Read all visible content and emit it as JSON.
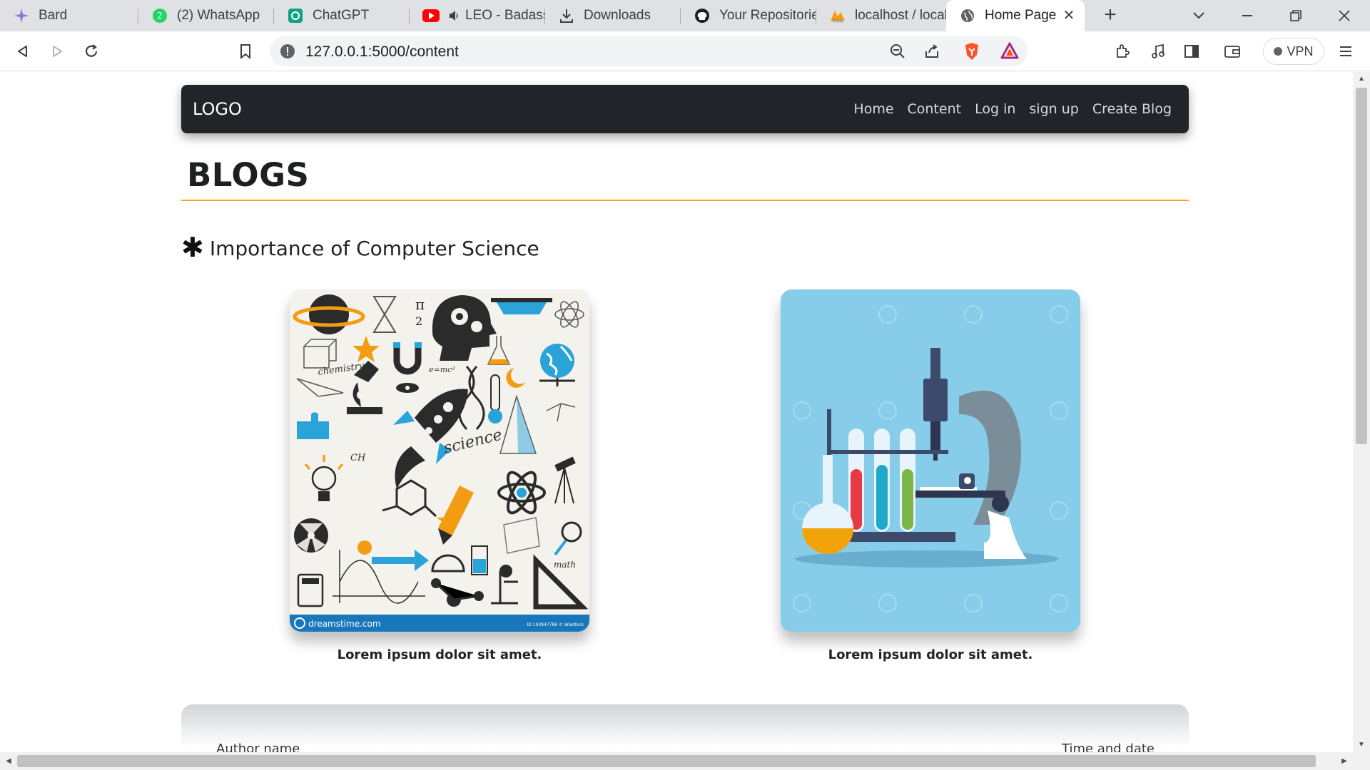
{
  "browser": {
    "tabs": [
      {
        "label": "Bard",
        "icon": "bard-icon"
      },
      {
        "label": "(2) WhatsApp",
        "icon": "whatsapp-icon",
        "badge": "2"
      },
      {
        "label": "ChatGPT",
        "icon": "chatgpt-icon"
      },
      {
        "label": "LEO - Badass",
        "icon": "youtube-icon"
      },
      {
        "label": "Downloads",
        "icon": "download-icon"
      },
      {
        "label": "Your Repositories",
        "icon": "github-icon"
      },
      {
        "label": "localhost / localhost",
        "icon": "phpmyadmin-icon"
      },
      {
        "label": "Home Page",
        "icon": "globe-icon",
        "active": true
      }
    ],
    "url": "127.0.0.1:5000/content",
    "vpn_label": "VPN"
  },
  "site": {
    "logo": "LOGO",
    "nav": [
      "Home",
      "Content",
      "Log in",
      "sign up",
      "Create Blog"
    ],
    "page_title": "BLOGS",
    "section_title": "Importance of Computer Science",
    "cards": [
      {
        "caption": "Lorem ipsum dolor sit amet.",
        "image_watermark": "dreamstime.com",
        "image_label": "science"
      },
      {
        "caption": "Lorem ipsum dolor sit amet."
      }
    ],
    "footer": {
      "author": "Author name",
      "datetime": "Time and date"
    }
  },
  "colors": {
    "navbar": "#212529",
    "accent_rule": "#f2a81d",
    "card2_bg": "#87cce8"
  }
}
